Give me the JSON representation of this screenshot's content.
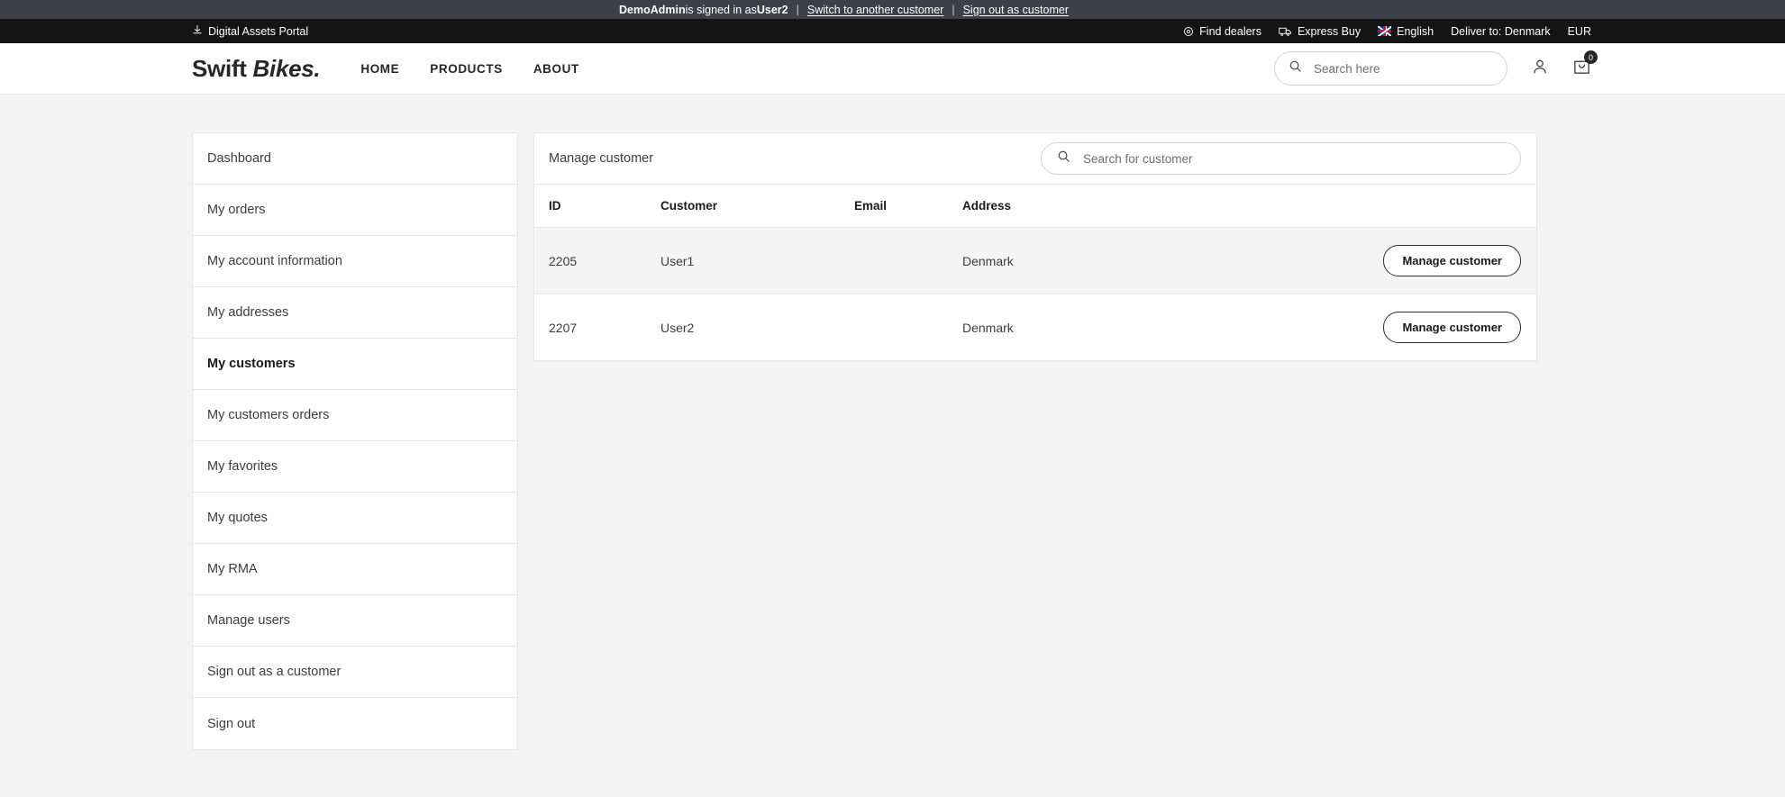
{
  "admin_bar": {
    "admin_name": "DemoAdmin",
    "signed_in_text": " is signed in as ",
    "customer_name": "User2",
    "switch_link": "Switch to another customer",
    "signout_link": "Sign out as customer",
    "separator": "|"
  },
  "util_bar": {
    "portal_link": "Digital Assets Portal",
    "find_dealers": "Find dealers",
    "express_buy": "Express Buy",
    "language": "English",
    "deliver_to": "Deliver to: Denmark",
    "currency": "EUR"
  },
  "header": {
    "logo_word1": "Swift",
    "logo_word2": "Bikes.",
    "nav": [
      {
        "label": "HOME"
      },
      {
        "label": "PRODUCTS"
      },
      {
        "label": "ABOUT"
      }
    ],
    "search_placeholder": "Search here",
    "search_value": "",
    "cart_count": "0"
  },
  "sidebar": {
    "items": [
      {
        "label": "Dashboard",
        "active": false
      },
      {
        "label": "My orders",
        "active": false
      },
      {
        "label": "My account information",
        "active": false
      },
      {
        "label": "My addresses",
        "active": false
      },
      {
        "label": "My customers",
        "active": true
      },
      {
        "label": "My customers orders",
        "active": false
      },
      {
        "label": "My favorites",
        "active": false
      },
      {
        "label": "My quotes",
        "active": false
      },
      {
        "label": "My RMA",
        "active": false
      },
      {
        "label": "Manage users",
        "active": false
      },
      {
        "label": "Sign out as a customer",
        "active": false
      },
      {
        "label": "Sign out",
        "active": false
      }
    ]
  },
  "panel": {
    "title": "Manage customer",
    "search_placeholder": "Search for customer",
    "search_value": "",
    "columns": [
      "ID",
      "Customer",
      "Email",
      "Address"
    ],
    "action_label": "Manage customer",
    "rows": [
      {
        "id": "2205",
        "customer": "User1",
        "email": "",
        "address": "Denmark",
        "action": "Manage customer"
      },
      {
        "id": "2207",
        "customer": "User2",
        "email": "",
        "address": "Denmark",
        "action": "Manage customer"
      }
    ]
  },
  "colors": {
    "admin_bar_bg": "#3d4049",
    "util_bar_bg": "#141414",
    "page_bg": "#f4f4f4",
    "text_dark": "#1a1a1a",
    "row_alt_bg": "#f4f4f4"
  }
}
